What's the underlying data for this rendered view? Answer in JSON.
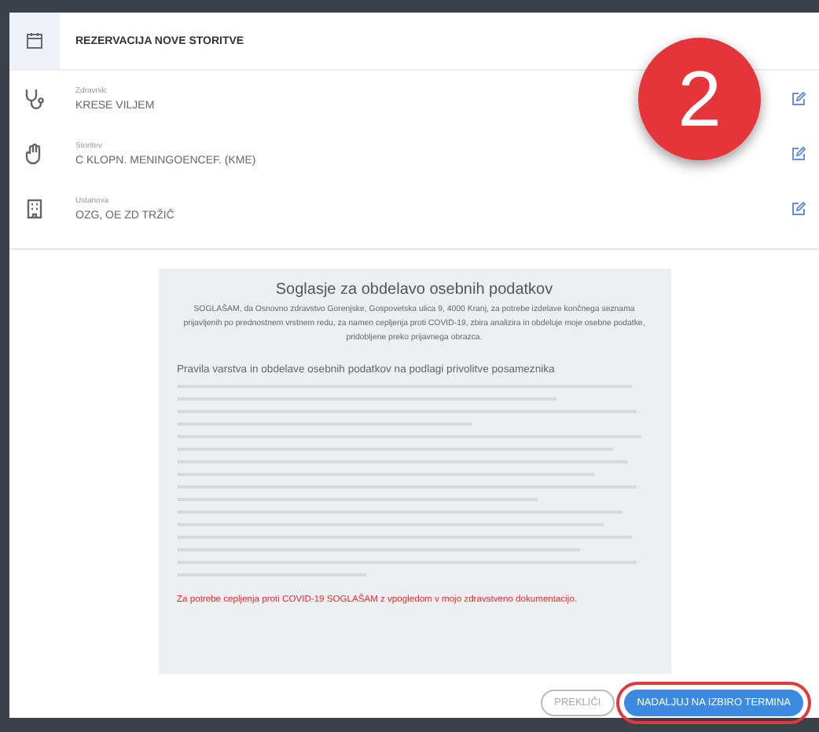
{
  "header": {
    "title": "REZERVACIJA NOVE STORITVE"
  },
  "fields": [
    {
      "kind": "doctor",
      "label": "Zdravnik:",
      "value": "KRESE VILJEM"
    },
    {
      "kind": "service",
      "label": "Storitev",
      "value": "C KLOPN. MENINGOENCEF. (KME)"
    },
    {
      "kind": "institution",
      "label": "Ustanova",
      "value": "OZG, OE ZD TRŽIČ"
    }
  ],
  "step_badge": "2",
  "consent": {
    "title": "Soglasje za obdelavo osebnih podatkov",
    "intro": "SOGLAŠAM, da Osnovno zdravstvo Gorenjske, Gospovetska ulica 9, 4000 Kranj, za potrebe izdelave končnega seznama prijavljenih po prednostnem vrstnem redu, za namen cepljenja proti COVID-19, zbira analizira in obdeluje moje osebne podatke, pridobljene preko prijavnega obrazca.",
    "subtitle": "Pravila varstva in obdelave osebnih podatkov na podlagi privolitve posameznika",
    "statement": "Za potrebe cepljenja proti COVID-19 SOGLAŠAM z vpogledom v mojo zdravstveno dokumentacijo."
  },
  "buttons": [
    {
      "kind": "secondary",
      "label": "PREKLIČI"
    },
    {
      "kind": "primary",
      "label": "NADALJUJ NA IZBIRO TERMINA",
      "highlighted": true
    }
  ]
}
